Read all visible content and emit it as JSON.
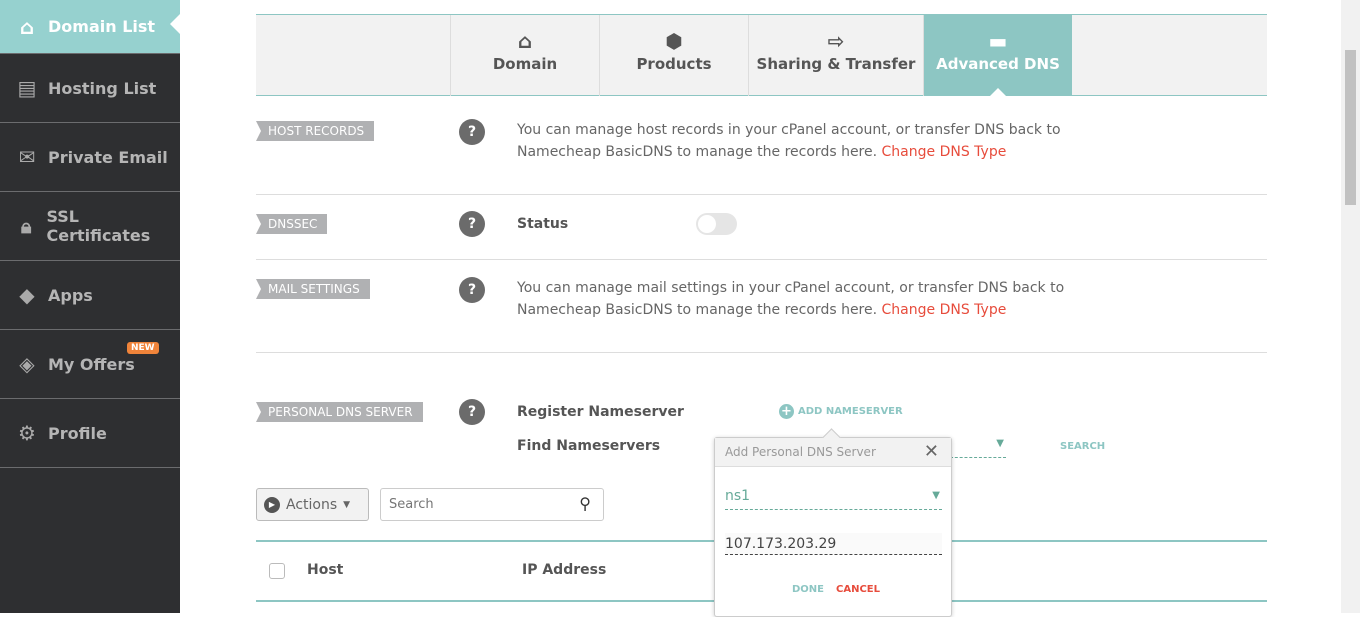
{
  "sidebar": {
    "items": [
      {
        "label": "Domain List",
        "icon": "home-icon"
      },
      {
        "label": "Hosting List",
        "icon": "server-icon"
      },
      {
        "label": "Private Email",
        "icon": "envelope-icon"
      },
      {
        "label": "SSL Certificates",
        "icon": "lock-icon"
      },
      {
        "label": "Apps",
        "icon": "apps-icon"
      },
      {
        "label": "My Offers",
        "icon": "tag-icon",
        "badge": "NEW"
      },
      {
        "label": "Profile",
        "icon": "gear-icon"
      }
    ]
  },
  "tabs": [
    {
      "label": "Domain",
      "icon": "home-icon"
    },
    {
      "label": "Products",
      "icon": "box-icon"
    },
    {
      "label": "Sharing & Transfer",
      "icon": "share-icon"
    },
    {
      "label": "Advanced DNS",
      "icon": "dns-icon",
      "active": true
    }
  ],
  "sections": {
    "host_records": {
      "label": "HOST RECORDS",
      "text": "You can manage host records in your cPanel account, or transfer DNS back to",
      "text2": "Namecheap BasicDNS to manage the records here.",
      "link": "Change DNS Type"
    },
    "dnssec": {
      "label": "DNSSEC",
      "status_label": "Status",
      "enabled": false
    },
    "mail": {
      "label": "MAIL SETTINGS",
      "text": "You can manage mail settings in your cPanel account, or transfer DNS back to",
      "text2": "Namecheap BasicDNS to manage the records here.",
      "link": "Change DNS Type"
    },
    "pdns": {
      "label": "PERSONAL DNS SERVER",
      "register_label": "Register Nameserver",
      "add_label": "ADD NAMESERVER",
      "find_label": "Find Nameservers",
      "search_label": "SEARCH"
    }
  },
  "toolbar": {
    "actions_label": "Actions",
    "search_placeholder": "Search"
  },
  "table": {
    "columns": [
      "Host",
      "IP Address"
    ]
  },
  "popup": {
    "title": "Add Personal DNS Server",
    "nameserver": "ns1",
    "ip": "107.173.203.29",
    "done": "DONE",
    "cancel": "CANCEL"
  },
  "colors": {
    "accent": "#8dc6c3",
    "link": "#e74c3c",
    "sidebar": "#2e2f31",
    "badge": "#f0843a"
  }
}
